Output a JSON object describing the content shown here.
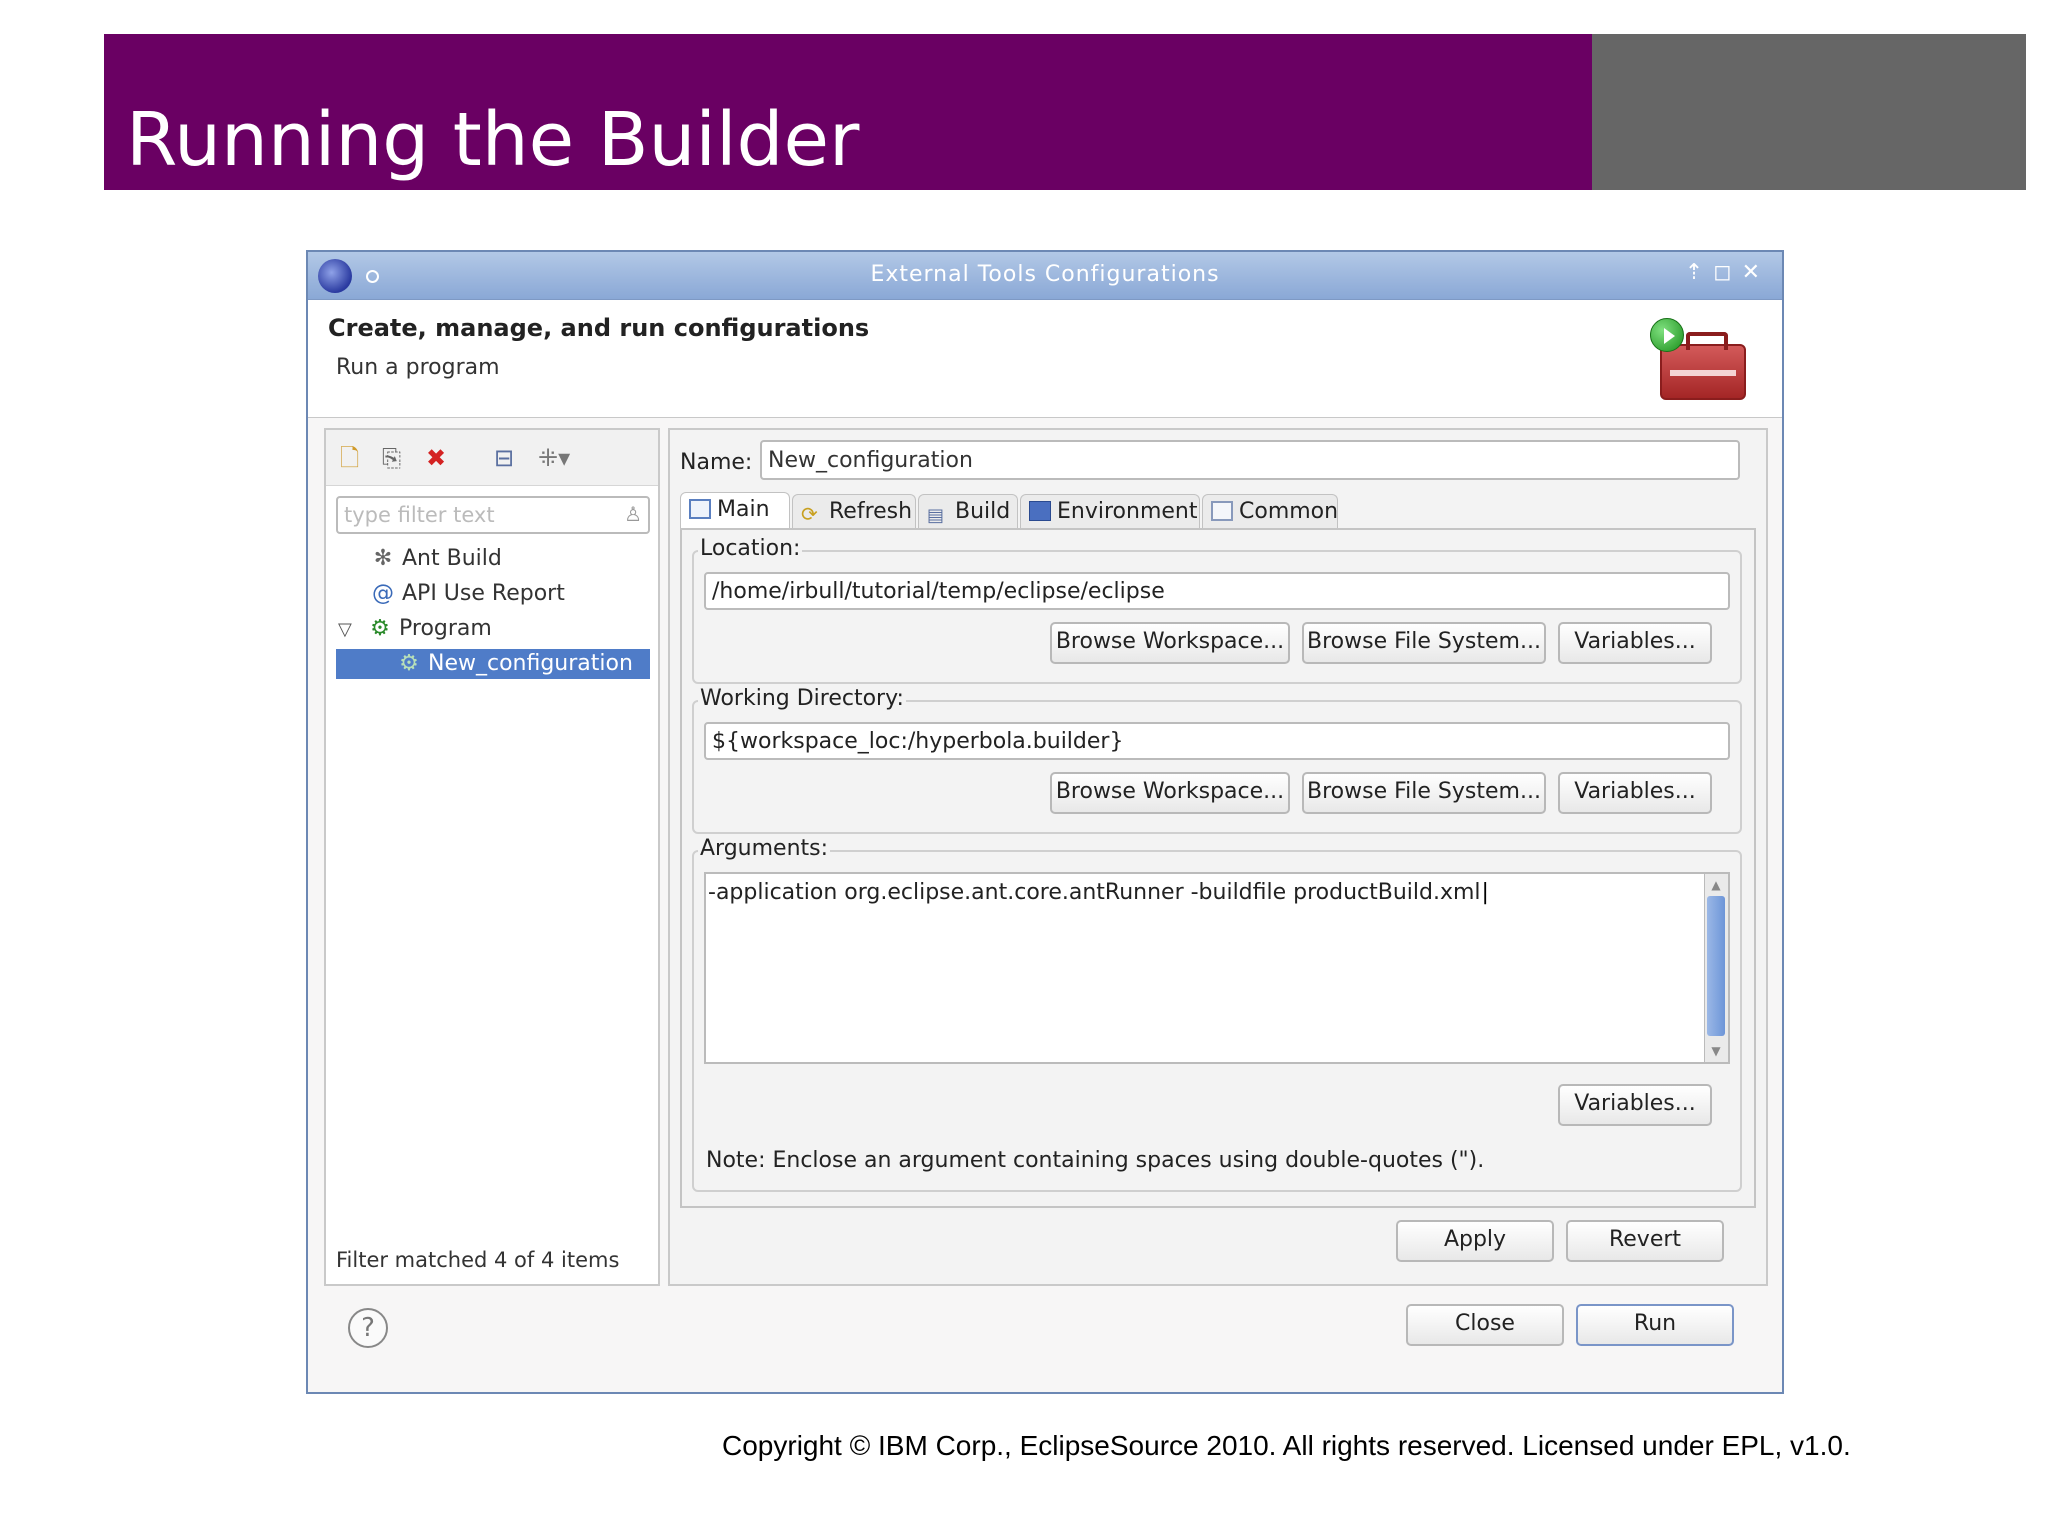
{
  "slide": {
    "title": "Running the Builder",
    "copyright": "Copyright © IBM Corp., EclipseSource 2010. All rights reserved.  Licensed under EPL, v1.0.",
    "colors": {
      "header": "#6a0063",
      "header_gray": "#666666"
    }
  },
  "dialog": {
    "title": "External Tools Configurations",
    "header_title": "Create, manage, and run configurations",
    "header_subtitle": "Run a program"
  },
  "left_panel": {
    "toolbar_icons": [
      "new-config-icon",
      "duplicate-icon",
      "delete-icon",
      "collapse-all-icon",
      "filter-icon"
    ],
    "filter_placeholder": "type filter text",
    "tree": [
      {
        "label": "Ant Build",
        "icon": "ant-build-icon"
      },
      {
        "label": "API Use Report",
        "icon": "api-report-icon"
      },
      {
        "label": "Program",
        "icon": "program-icon",
        "expanded": true
      },
      {
        "label": "New_configuration",
        "icon": "config-icon",
        "selected": true
      }
    ],
    "filter_status": "Filter matched 4 of 4 items"
  },
  "right_panel": {
    "name_label": "Name:",
    "name_value": "New_configuration",
    "tabs": [
      {
        "label": "Main",
        "icon": "main-tab-icon",
        "active": true
      },
      {
        "label": "Refresh",
        "icon": "refresh-icon"
      },
      {
        "label": "Build",
        "icon": "build-icon"
      },
      {
        "label": "Environment",
        "icon": "environment-icon"
      },
      {
        "label": "Common",
        "icon": "common-icon"
      }
    ],
    "location": {
      "label": "Location:",
      "value": "/home/irbull/tutorial/temp/eclipse/eclipse",
      "buttons": [
        "Browse Workspace...",
        "Browse File System...",
        "Variables..."
      ]
    },
    "working_directory": {
      "label": "Working Directory:",
      "value": "${workspace_loc:/hyperbola.builder}",
      "buttons": [
        "Browse Workspace...",
        "Browse File System...",
        "Variables..."
      ]
    },
    "arguments": {
      "label": "Arguments:",
      "value": "-application org.eclipse.ant.core.antRunner -buildfile productBuild.xml",
      "button": "Variables..."
    },
    "note": "Note: Enclose an argument containing spaces using double-quotes (\").",
    "apply_label": "Apply",
    "revert_label": "Revert"
  },
  "footer": {
    "close_label": "Close",
    "run_label": "Run"
  }
}
